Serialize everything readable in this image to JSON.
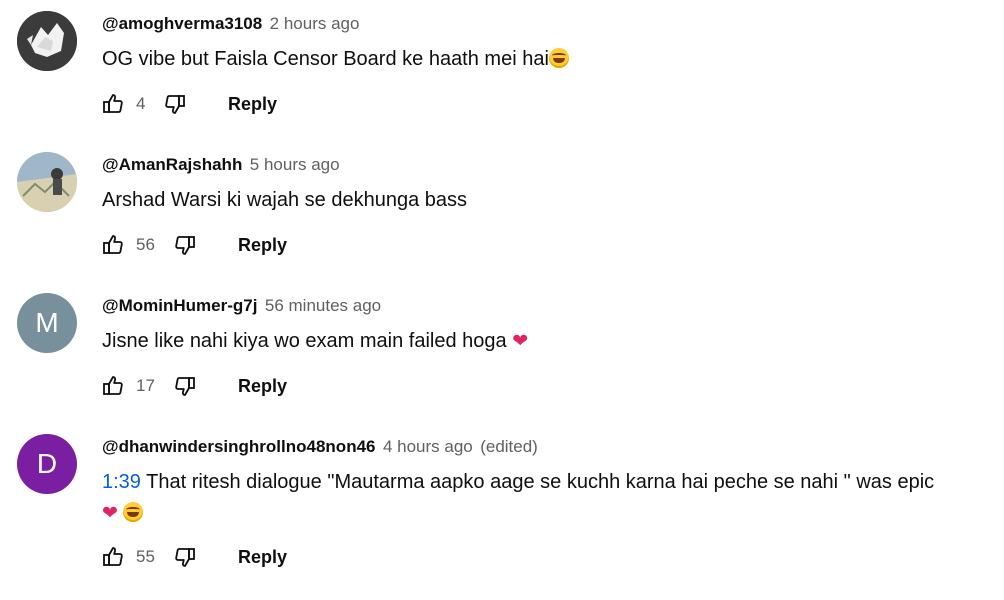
{
  "comments": [
    {
      "author": "@amoghverma3108",
      "time": "2 hours ago",
      "text": "OG vibe but Faisla Censor Board ke haath mei hai",
      "emoji": "laughing-tears",
      "likes": "4",
      "reply_label": "Reply",
      "avatar": {
        "type": "image",
        "bg": "#4a4a4a"
      }
    },
    {
      "author": "@AmanRajshahh",
      "time": "5 hours ago",
      "text": "Arshad Warsi ki wajah se dekhunga bass",
      "likes": "56",
      "reply_label": "Reply",
      "avatar": {
        "type": "image",
        "bg": "#c9d8c4"
      }
    },
    {
      "author": "@MominHumer-g7j",
      "time": "56 minutes ago",
      "text": "Jisne like nahi kiya wo exam main failed hoga ",
      "emoji": "red-heart",
      "likes": "17",
      "reply_label": "Reply",
      "avatar": {
        "type": "letter",
        "letter": "M",
        "bg": "#78909c"
      }
    },
    {
      "author": "@dhanwindersinghrollno48non46",
      "time": "4 hours ago",
      "edited": "(edited)",
      "timestamp_link": "1:39",
      "text": " That ritesh dialogue \"Mautarma aapko aage se kuchh karna hai peche se nahi \" was epic",
      "emoji": "red-heart, laughing-tears",
      "likes": "55",
      "reply_label": "Reply",
      "avatar": {
        "type": "letter",
        "letter": "D",
        "bg": "#7b1fa2"
      }
    }
  ],
  "colors": {
    "link": "#065fd4",
    "secondary_text": "#606060",
    "primary_text": "#0f0f0f"
  },
  "icons": {
    "like": "thumbs-up-outline-icon",
    "dislike": "thumbs-down-outline-icon"
  }
}
